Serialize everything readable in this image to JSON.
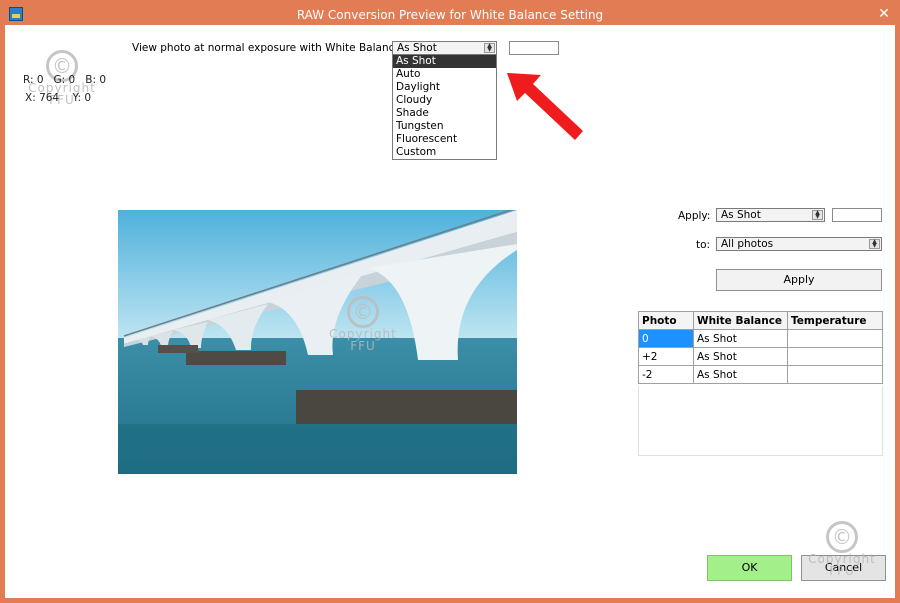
{
  "window": {
    "title": "RAW Conversion Preview for White Balance Setting"
  },
  "readout": {
    "r": "R: 0",
    "g": "G: 0",
    "b": "B: 0",
    "x": "X: 764",
    "y": "Y: 0"
  },
  "view": {
    "label": "View photo at normal exposure with White Balance:",
    "selected": "As Shot",
    "options": [
      "As Shot",
      "Auto",
      "Daylight",
      "Cloudy",
      "Shade",
      "Tungsten",
      "Fluorescent",
      "Custom"
    ]
  },
  "apply": {
    "label": "Apply:",
    "selected": "As Shot",
    "to_label": "to:",
    "to_selected": "All photos",
    "button": "Apply"
  },
  "table": {
    "headers": [
      "Photo",
      "White Balance",
      "Temperature"
    ],
    "rows": [
      [
        "0",
        "As Shot",
        ""
      ],
      [
        "+2",
        "As Shot",
        ""
      ],
      [
        "-2",
        "As Shot",
        ""
      ]
    ]
  },
  "footer": {
    "ok": "OK",
    "cancel": "Cancel"
  },
  "watermark": {
    "symbol": "©",
    "line1": "Copyright",
    "line2": "FFU"
  },
  "colors": {
    "titlebar": "#e27c55",
    "ok_button": "#a3f08a",
    "selection": "#1e90ff",
    "arrow": "#ee1c1c"
  },
  "icons": {
    "close": "close-icon",
    "app": "app-icon",
    "annotation": "red-arrow-icon"
  }
}
